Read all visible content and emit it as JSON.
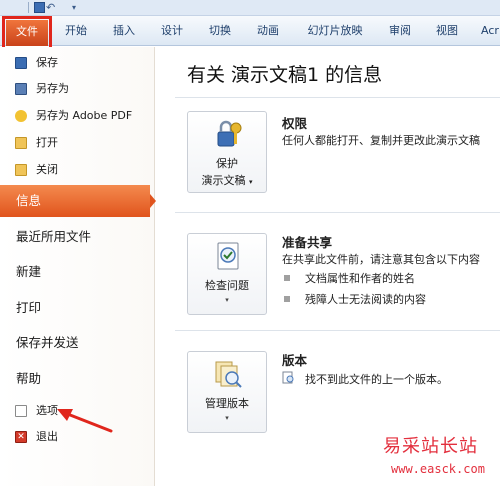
{
  "ribbon": {
    "tabs": [
      "文件",
      "开始",
      "插入",
      "设计",
      "切换",
      "动画",
      "幻灯片放映",
      "审阅",
      "视图",
      "Acr"
    ]
  },
  "backstage": {
    "commands": [
      {
        "label": "保存",
        "icon": "save-icon"
      },
      {
        "label": "另存为",
        "icon": "save-as-icon"
      },
      {
        "label": "另存为 Adobe PDF",
        "icon": "adobe-pdf-icon"
      },
      {
        "label": "打开",
        "icon": "open-folder-icon"
      },
      {
        "label": "关闭",
        "icon": "close-folder-icon"
      }
    ],
    "tabs": [
      "信息",
      "最近所用文件",
      "新建",
      "打印",
      "保存并发送",
      "帮助"
    ],
    "active_tab": "信息",
    "bottom_commands": [
      {
        "label": "选项",
        "icon": "options-icon"
      },
      {
        "label": "退出",
        "icon": "exit-icon"
      }
    ]
  },
  "info": {
    "title": "有关 演示文稿1 的信息",
    "sections": [
      {
        "button_label_1": "保护",
        "button_label_2": "演示文稿",
        "heading": "权限",
        "text": "任何人都能打开、复制并更改此演示文稿"
      },
      {
        "button_label_1": "检查问题",
        "heading": "准备共享",
        "text": "在共享此文件前，请注意其包含以下内容",
        "bullets": [
          "文档属性和作者的姓名",
          "残障人士无法阅读的内容"
        ]
      },
      {
        "button_label_1": "管理版本",
        "heading": "版本",
        "text": "找不到此文件的上一个版本。"
      }
    ]
  },
  "watermark": {
    "text": "易采站长站",
    "url": "www.easck.com"
  },
  "colors": {
    "file_tab": "#d24a1f",
    "active_tab": "#e96a2d",
    "annotation": "#e0261c",
    "watermark": "#e3303e"
  }
}
